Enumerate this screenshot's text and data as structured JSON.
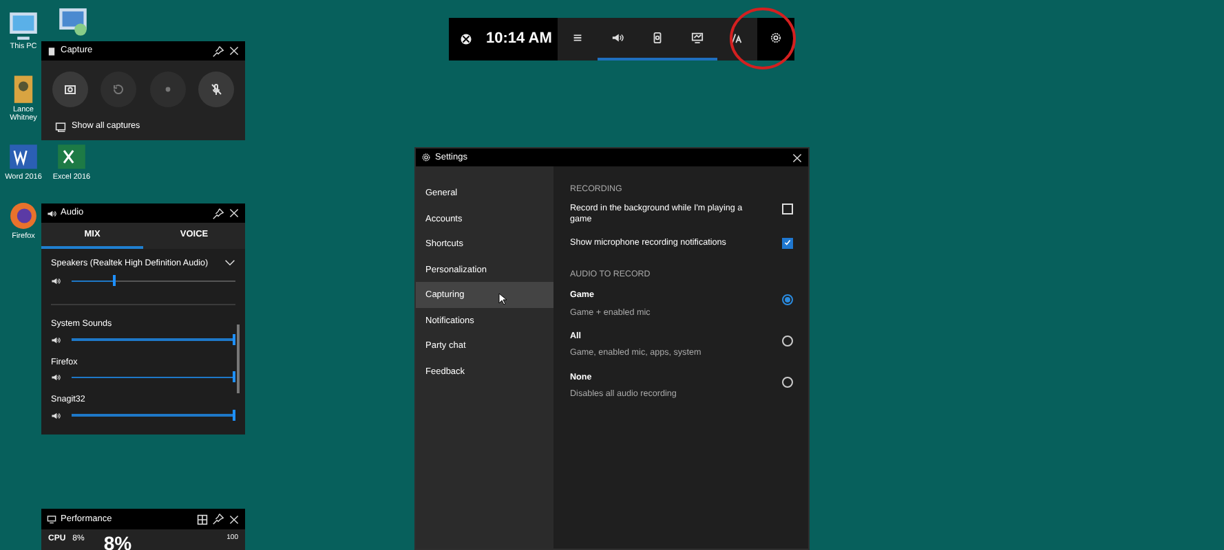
{
  "desktop_icons": [
    {
      "label": "This PC",
      "kind": "pc"
    },
    {
      "label": "Lance Whitney",
      "kind": "user"
    },
    {
      "label": "Word 2016",
      "kind": "word"
    },
    {
      "label": "Excel 2016",
      "kind": "excel"
    },
    {
      "label": "Firefox",
      "kind": "firefox"
    }
  ],
  "game_bar": {
    "time": "10:14 AM",
    "buttons": [
      {
        "kind": "menu",
        "active": false
      },
      {
        "kind": "audio",
        "active": true
      },
      {
        "kind": "capture",
        "active": true
      },
      {
        "kind": "performance",
        "active": true
      },
      {
        "kind": "lfg",
        "active": false
      },
      {
        "kind": "settings",
        "active": false
      }
    ]
  },
  "capture": {
    "title": "Capture",
    "buttons": [
      {
        "kind": "screenshot",
        "disabled": false
      },
      {
        "kind": "record-last",
        "disabled": true
      },
      {
        "kind": "record",
        "disabled": true
      },
      {
        "kind": "mic",
        "disabled": false
      }
    ],
    "link": "Show all captures"
  },
  "audio": {
    "title": "Audio",
    "tabs": [
      {
        "label": "MIX",
        "selected": true
      },
      {
        "label": "VOICE",
        "selected": false
      }
    ],
    "device": {
      "name": "Speakers (Realtek High Definition Audio)",
      "level": 0.27
    },
    "apps": [
      {
        "name": "System Sounds",
        "level": 1.0
      },
      {
        "name": "Firefox",
        "level": 1.0
      },
      {
        "name": "Snagit32",
        "level": 1.0
      }
    ]
  },
  "performance": {
    "title": "Performance",
    "cpu_label": "CPU",
    "cpu_value": "8%",
    "big_value": "8%",
    "max": "100"
  },
  "settings": {
    "title": "Settings",
    "nav": [
      {
        "label": "General",
        "selected": false
      },
      {
        "label": "Accounts",
        "selected": false
      },
      {
        "label": "Shortcuts",
        "selected": false
      },
      {
        "label": "Personalization",
        "selected": false
      },
      {
        "label": "Capturing",
        "selected": true
      },
      {
        "label": "Notifications",
        "selected": false
      },
      {
        "label": "Party chat",
        "selected": false
      },
      {
        "label": "Feedback",
        "selected": false
      }
    ],
    "recording_heading": "RECORDING",
    "checkboxes": [
      {
        "label": "Record in the background while I'm playing a game",
        "checked": false
      },
      {
        "label": "Show microphone recording notifications",
        "checked": true
      }
    ],
    "audio_heading": "AUDIO TO RECORD",
    "radios": [
      {
        "title": "Game",
        "description": "Game + enabled mic",
        "selected": true
      },
      {
        "title": "All",
        "description": "Game, enabled mic, apps, system",
        "selected": false
      },
      {
        "title": "None",
        "description": "Disables all audio recording",
        "selected": false
      }
    ]
  }
}
